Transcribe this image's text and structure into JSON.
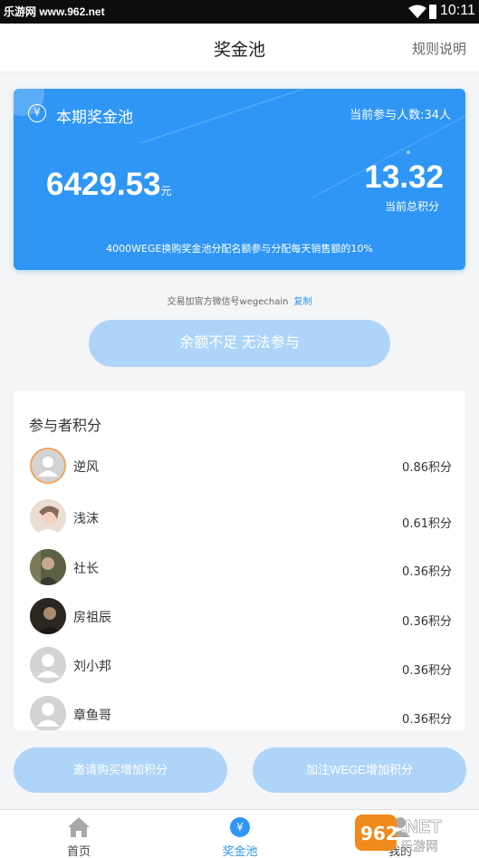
{
  "status_bar": {
    "watermark": "乐游网 www.962.net",
    "time": "10:11"
  },
  "header": {
    "title": "奖金池",
    "rules_link": "规则说明"
  },
  "pool": {
    "currency_symbol": "¥",
    "title": "本期奖金池",
    "participants_count": "当前参与人数:34人",
    "amount": "6429.53",
    "amount_unit": "元",
    "total_score": "13.32",
    "total_score_label": "当前总积分",
    "description": "4000WEGE换购奖金池分配名额参与分配每天销售额的10%"
  },
  "wechat": {
    "text": "交易加官方微信号wegechain",
    "copy_label": "复制"
  },
  "join_button": "余额不足 无法参与",
  "participants": {
    "title": "参与者积分",
    "rows": [
      {
        "name": "逆风",
        "points": "0.86积分"
      },
      {
        "name": "浅沫",
        "points": "0.61积分"
      },
      {
        "name": "社长",
        "points": "0.36积分"
      },
      {
        "name": "房祖辰",
        "points": "0.36积分"
      },
      {
        "name": "刘小邦",
        "points": "0.36积分"
      },
      {
        "name": "章鱼哥",
        "points": "0.36积分"
      }
    ]
  },
  "actions": {
    "invite": "邀请购买增加积分",
    "follow": "加注WEGE增加积分"
  },
  "tabs": {
    "home": "首页",
    "pool": "奖金池",
    "mine": "我的",
    "pool_icon": "¥"
  },
  "corner_watermark": "962.NET 乐游网",
  "colors": {
    "primary": "#2f96f5",
    "disabled_button": "#aed4f8"
  }
}
